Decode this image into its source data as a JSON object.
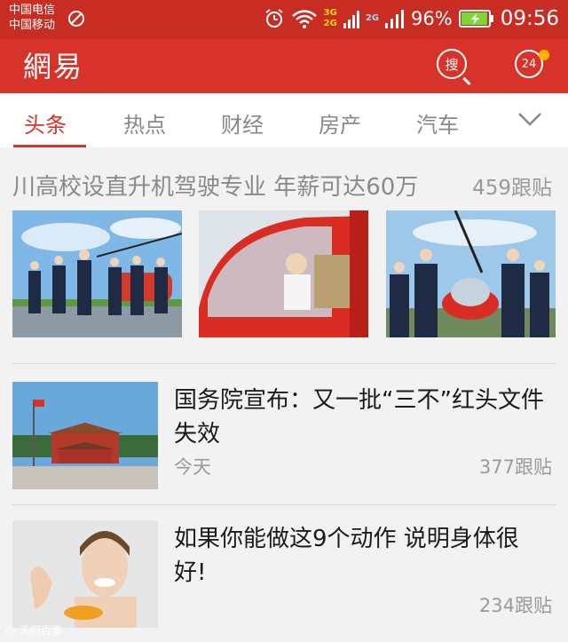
{
  "status_bar": {
    "carrier_1": "中国电信",
    "carrier_2": "中国移动",
    "net_a": "3G",
    "net_b": "2G",
    "net_c": "2G",
    "battery": "96%",
    "time": "09:56",
    "battery_level": 0.96
  },
  "header": {
    "logo": "網易",
    "search_label": "搜",
    "message_count": "24",
    "colors": {
      "status_bar": "#c92c22",
      "app_bar": "#d8332b",
      "badge": "#ffb400"
    }
  },
  "tabs": [
    {
      "label": "头条",
      "active": true
    },
    {
      "label": "热点",
      "active": false
    },
    {
      "label": "财经",
      "active": false
    },
    {
      "label": "房产",
      "active": false
    },
    {
      "label": "汽车",
      "active": false
    }
  ],
  "feed": {
    "headline": {
      "title": "川高校设直升机驾驶专业 年薪可达60万",
      "comments": "459跟贴"
    },
    "items": [
      {
        "title": "国务院宣布：又一批“三不”红头文件失效",
        "time": "今天",
        "comments": "377跟贴"
      },
      {
        "title": "如果你能做这9个动作 说明身体很好!",
        "comments": "234跟贴"
      }
    ]
  },
  "watermark": "@ 天府百事"
}
